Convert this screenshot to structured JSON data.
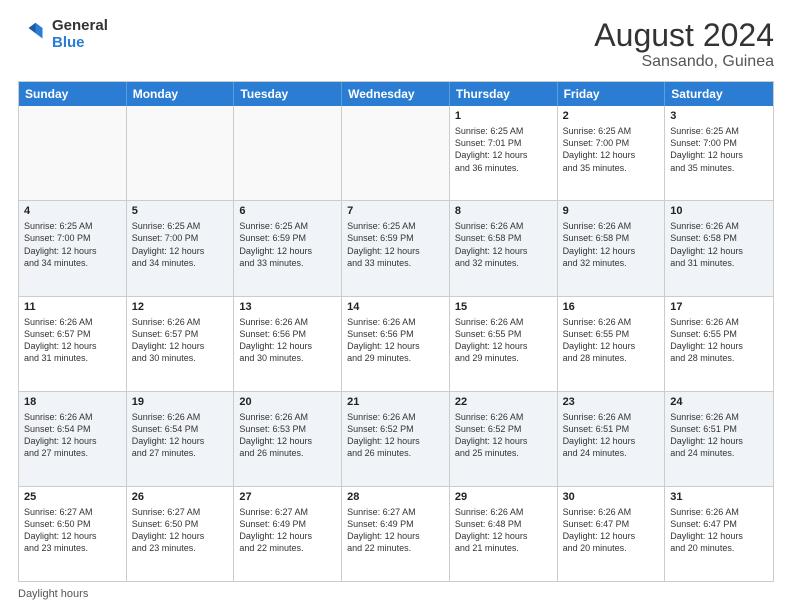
{
  "header": {
    "logo_general": "General",
    "logo_blue": "Blue",
    "month_title": "August 2024",
    "location": "Sansando, Guinea"
  },
  "weekdays": [
    "Sunday",
    "Monday",
    "Tuesday",
    "Wednesday",
    "Thursday",
    "Friday",
    "Saturday"
  ],
  "footer": {
    "daylight_hours_label": "Daylight hours"
  },
  "rows": [
    {
      "alt": false,
      "cells": [
        {
          "day": "",
          "text": ""
        },
        {
          "day": "",
          "text": ""
        },
        {
          "day": "",
          "text": ""
        },
        {
          "day": "",
          "text": ""
        },
        {
          "day": "1",
          "text": "Sunrise: 6:25 AM\nSunset: 7:01 PM\nDaylight: 12 hours\nand 36 minutes."
        },
        {
          "day": "2",
          "text": "Sunrise: 6:25 AM\nSunset: 7:00 PM\nDaylight: 12 hours\nand 35 minutes."
        },
        {
          "day": "3",
          "text": "Sunrise: 6:25 AM\nSunset: 7:00 PM\nDaylight: 12 hours\nand 35 minutes."
        }
      ]
    },
    {
      "alt": true,
      "cells": [
        {
          "day": "4",
          "text": "Sunrise: 6:25 AM\nSunset: 7:00 PM\nDaylight: 12 hours\nand 34 minutes."
        },
        {
          "day": "5",
          "text": "Sunrise: 6:25 AM\nSunset: 7:00 PM\nDaylight: 12 hours\nand 34 minutes."
        },
        {
          "day": "6",
          "text": "Sunrise: 6:25 AM\nSunset: 6:59 PM\nDaylight: 12 hours\nand 33 minutes."
        },
        {
          "day": "7",
          "text": "Sunrise: 6:25 AM\nSunset: 6:59 PM\nDaylight: 12 hours\nand 33 minutes."
        },
        {
          "day": "8",
          "text": "Sunrise: 6:26 AM\nSunset: 6:58 PM\nDaylight: 12 hours\nand 32 minutes."
        },
        {
          "day": "9",
          "text": "Sunrise: 6:26 AM\nSunset: 6:58 PM\nDaylight: 12 hours\nand 32 minutes."
        },
        {
          "day": "10",
          "text": "Sunrise: 6:26 AM\nSunset: 6:58 PM\nDaylight: 12 hours\nand 31 minutes."
        }
      ]
    },
    {
      "alt": false,
      "cells": [
        {
          "day": "11",
          "text": "Sunrise: 6:26 AM\nSunset: 6:57 PM\nDaylight: 12 hours\nand 31 minutes."
        },
        {
          "day": "12",
          "text": "Sunrise: 6:26 AM\nSunset: 6:57 PM\nDaylight: 12 hours\nand 30 minutes."
        },
        {
          "day": "13",
          "text": "Sunrise: 6:26 AM\nSunset: 6:56 PM\nDaylight: 12 hours\nand 30 minutes."
        },
        {
          "day": "14",
          "text": "Sunrise: 6:26 AM\nSunset: 6:56 PM\nDaylight: 12 hours\nand 29 minutes."
        },
        {
          "day": "15",
          "text": "Sunrise: 6:26 AM\nSunset: 6:55 PM\nDaylight: 12 hours\nand 29 minutes."
        },
        {
          "day": "16",
          "text": "Sunrise: 6:26 AM\nSunset: 6:55 PM\nDaylight: 12 hours\nand 28 minutes."
        },
        {
          "day": "17",
          "text": "Sunrise: 6:26 AM\nSunset: 6:55 PM\nDaylight: 12 hours\nand 28 minutes."
        }
      ]
    },
    {
      "alt": true,
      "cells": [
        {
          "day": "18",
          "text": "Sunrise: 6:26 AM\nSunset: 6:54 PM\nDaylight: 12 hours\nand 27 minutes."
        },
        {
          "day": "19",
          "text": "Sunrise: 6:26 AM\nSunset: 6:54 PM\nDaylight: 12 hours\nand 27 minutes."
        },
        {
          "day": "20",
          "text": "Sunrise: 6:26 AM\nSunset: 6:53 PM\nDaylight: 12 hours\nand 26 minutes."
        },
        {
          "day": "21",
          "text": "Sunrise: 6:26 AM\nSunset: 6:52 PM\nDaylight: 12 hours\nand 26 minutes."
        },
        {
          "day": "22",
          "text": "Sunrise: 6:26 AM\nSunset: 6:52 PM\nDaylight: 12 hours\nand 25 minutes."
        },
        {
          "day": "23",
          "text": "Sunrise: 6:26 AM\nSunset: 6:51 PM\nDaylight: 12 hours\nand 24 minutes."
        },
        {
          "day": "24",
          "text": "Sunrise: 6:26 AM\nSunset: 6:51 PM\nDaylight: 12 hours\nand 24 minutes."
        }
      ]
    },
    {
      "alt": false,
      "cells": [
        {
          "day": "25",
          "text": "Sunrise: 6:27 AM\nSunset: 6:50 PM\nDaylight: 12 hours\nand 23 minutes."
        },
        {
          "day": "26",
          "text": "Sunrise: 6:27 AM\nSunset: 6:50 PM\nDaylight: 12 hours\nand 23 minutes."
        },
        {
          "day": "27",
          "text": "Sunrise: 6:27 AM\nSunset: 6:49 PM\nDaylight: 12 hours\nand 22 minutes."
        },
        {
          "day": "28",
          "text": "Sunrise: 6:27 AM\nSunset: 6:49 PM\nDaylight: 12 hours\nand 22 minutes."
        },
        {
          "day": "29",
          "text": "Sunrise: 6:26 AM\nSunset: 6:48 PM\nDaylight: 12 hours\nand 21 minutes."
        },
        {
          "day": "30",
          "text": "Sunrise: 6:26 AM\nSunset: 6:47 PM\nDaylight: 12 hours\nand 20 minutes."
        },
        {
          "day": "31",
          "text": "Sunrise: 6:26 AM\nSunset: 6:47 PM\nDaylight: 12 hours\nand 20 minutes."
        }
      ]
    }
  ]
}
